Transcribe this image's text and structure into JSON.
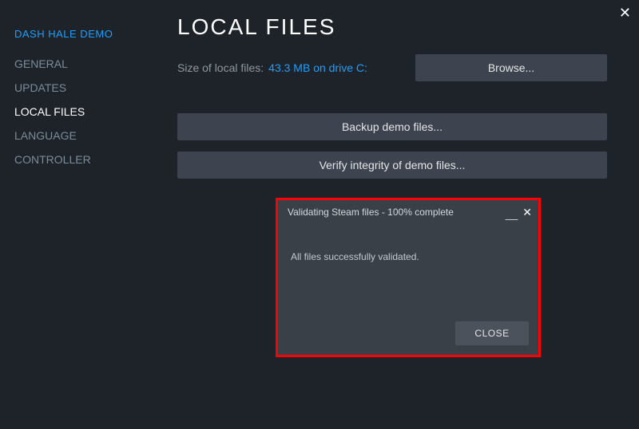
{
  "app": {
    "title": "DASH HALE DEMO"
  },
  "sidebar": {
    "items": [
      {
        "label": "GENERAL"
      },
      {
        "label": "UPDATES"
      },
      {
        "label": "LOCAL FILES"
      },
      {
        "label": "LANGUAGE"
      },
      {
        "label": "CONTROLLER"
      }
    ],
    "activeIndex": 2
  },
  "main": {
    "title": "LOCAL FILES",
    "size_label": "Size of local files:",
    "size_value": "43.3 MB on drive C:",
    "browse_label": "Browse...",
    "backup_label": "Backup demo files...",
    "verify_label": "Verify integrity of demo files..."
  },
  "dialog": {
    "title": "Validating Steam files - 100% complete",
    "message": "All files successfully validated.",
    "close_label": "CLOSE"
  }
}
